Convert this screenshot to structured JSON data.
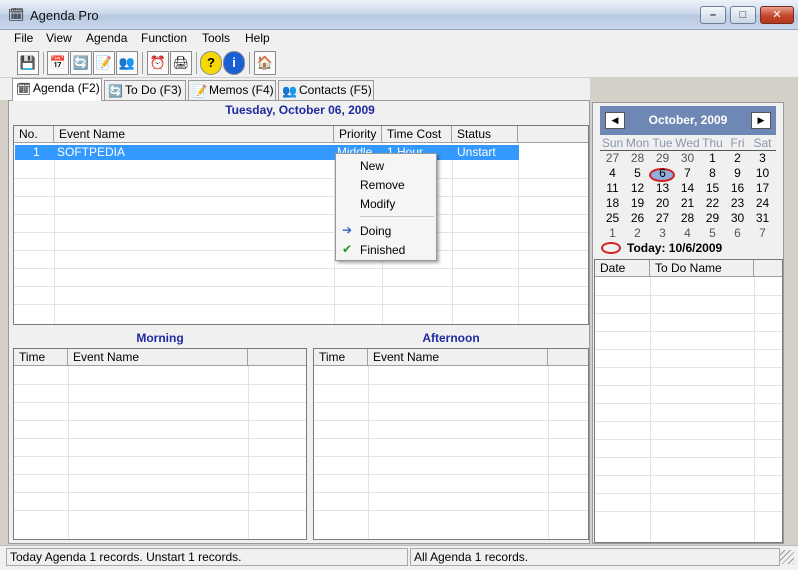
{
  "window": {
    "title": "Agenda Pro",
    "minimize": "–",
    "maximize": "□",
    "close": "✕"
  },
  "menu": [
    "File",
    "View",
    "Agenda",
    "Function",
    "Tools",
    "Help"
  ],
  "toolbar_icons": [
    "save-icon",
    "calendar-icon",
    "todo-icon",
    "memo-icon",
    "contacts-icon",
    "alarm-icon",
    "print-icon",
    "help-icon",
    "info-icon",
    "home-icon"
  ],
  "toolbar_glyphs": [
    "💾",
    "📅",
    "🔄",
    "📝",
    "👥",
    "⏰",
    "🖨",
    "?",
    "i",
    "🏠"
  ],
  "tabs": [
    {
      "label": "Agenda (F2)",
      "icon": "🗓"
    },
    {
      "label": "To Do (F3)",
      "icon": "🔄"
    },
    {
      "label": "Memos (F4)",
      "icon": "📝"
    },
    {
      "label": "Contacts (F5)",
      "icon": "👥"
    }
  ],
  "agenda": {
    "date_header": "Tuesday, October 06, 2009",
    "columns": [
      "No.",
      "Event Name",
      "Priority",
      "Time Cost",
      "Status"
    ],
    "rows": [
      {
        "marker": "✖",
        "no": "1",
        "event": "SOFTPEDIA",
        "priority": "Middle",
        "time_cost": "1 Hour",
        "status": "Unstart"
      }
    ]
  },
  "context_menu": {
    "items": [
      "New",
      "Remove",
      "Modify"
    ],
    "status_items": [
      {
        "label": "Doing",
        "icon": "➔"
      },
      {
        "label": "Finished",
        "icon": "✔"
      }
    ]
  },
  "morning": {
    "title": "Morning",
    "columns": [
      "Time",
      "Event Name"
    ]
  },
  "afternoon": {
    "title": "Afternoon",
    "columns": [
      "Time",
      "Event Name"
    ]
  },
  "calendar": {
    "month_label": "October, 2009",
    "prev": "◀",
    "next": "▶",
    "weekdays": [
      "Sun",
      "Mon",
      "Tue",
      "Wed",
      "Thu",
      "Fri",
      "Sat"
    ],
    "weeks": [
      [
        "27",
        "28",
        "29",
        "30",
        "1",
        "2",
        "3"
      ],
      [
        "4",
        "5",
        "6",
        "7",
        "8",
        "9",
        "10"
      ],
      [
        "11",
        "12",
        "13",
        "14",
        "15",
        "16",
        "17"
      ],
      [
        "18",
        "19",
        "20",
        "21",
        "22",
        "23",
        "24"
      ],
      [
        "25",
        "26",
        "27",
        "28",
        "29",
        "30",
        "31"
      ],
      [
        "1",
        "2",
        "3",
        "4",
        "5",
        "6",
        "7"
      ]
    ],
    "today_label": "Today: 10/6/2009"
  },
  "todo": {
    "columns": [
      "Date",
      "To Do Name"
    ]
  },
  "status": {
    "left": "Today Agenda 1 records. Unstart 1 records.",
    "right": "All Agenda 1 records."
  }
}
